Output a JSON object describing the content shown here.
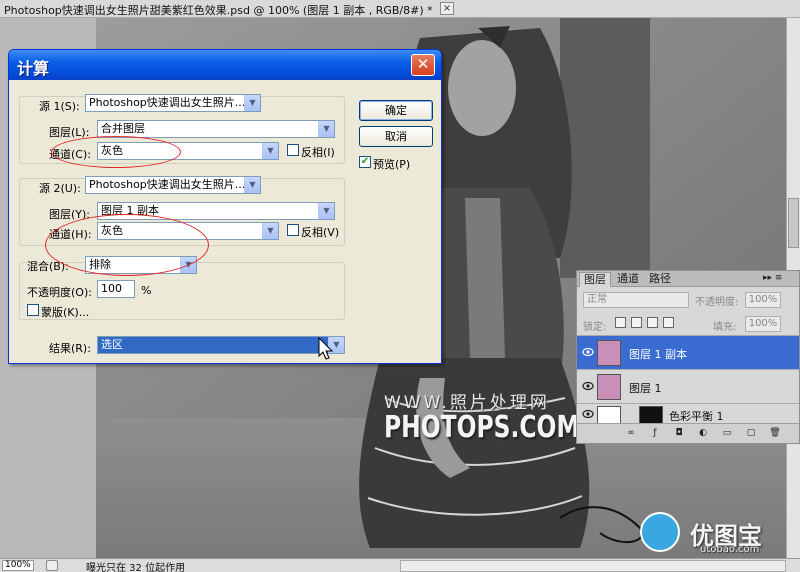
{
  "document": {
    "title": "Photoshop快速调出女生照片甜美紫红色效果.psd @ 100% (图层 1 副本 , RGB/8#) *",
    "close": "×"
  },
  "status": {
    "zoom": "100%",
    "message": "曝光只在 32 位起作用"
  },
  "watermark": {
    "line1": "WWW.照片处理网",
    "line2": "PHOTOPS.COM",
    "brand": "优图宝",
    "url": "utobao.com"
  },
  "dialog": {
    "title": "计算",
    "close": "✕",
    "source1": {
      "label": "源 1(S):",
      "value": "Photoshop快速调出女生照片...",
      "layer_label": "图层(L):",
      "layer_value": "合并图层",
      "channel_label": "通道(C):",
      "channel_value": "灰色",
      "invert_label": "反相(I)"
    },
    "source2": {
      "label": "源 2(U):",
      "value": "Photoshop快速调出女生照片...",
      "layer_label": "图层(Y):",
      "layer_value": "图层 1 副本",
      "channel_label": "通道(H):",
      "channel_value": "灰色",
      "invert_label": "反相(V)"
    },
    "blending": {
      "label": "混合(B):",
      "value": "排除",
      "opacity_label": "不透明度(O):",
      "opacity_value": "100",
      "opacity_unit": "%",
      "mask_label": "蒙版(K)..."
    },
    "result": {
      "label": "结果(R):",
      "value": "选区"
    },
    "ok_label": "确定",
    "cancel_label": "取消",
    "preview_label": "预览(P)",
    "preview_checked": true
  },
  "layers_panel": {
    "tabs": [
      "图层",
      "通道",
      "路径"
    ],
    "menu_glyph": "▸▸ ≡",
    "blend_mode": "正常",
    "opacity_label": "不透明度:",
    "opacity_value": "100%",
    "lock_label": "锁定:",
    "fill_label": "填充:",
    "fill_value": "100%",
    "layers": [
      {
        "name": "图层 1 副本",
        "selected": true
      },
      {
        "name": "图层 1",
        "selected": false
      },
      {
        "name": "色彩平衡 1",
        "selected": false
      }
    ],
    "selected_color": "#3a6bd1"
  },
  "colors": {
    "xp_title": "#0a5fe8",
    "annotation_red": "#e02828"
  }
}
